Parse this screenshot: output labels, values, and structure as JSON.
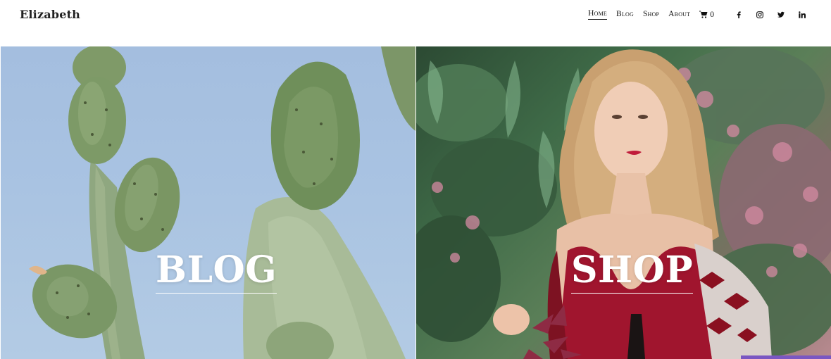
{
  "site": {
    "logo": "Elizabeth"
  },
  "nav": {
    "items": [
      {
        "label": "Home",
        "active": true
      },
      {
        "label": "Blog",
        "active": false
      },
      {
        "label": "Shop",
        "active": false
      },
      {
        "label": "About",
        "active": false
      }
    ],
    "cart": {
      "icon": "cart-icon",
      "count": "0"
    },
    "social": [
      "facebook-icon",
      "instagram-icon",
      "twitter-icon",
      "linkedin-icon"
    ]
  },
  "panels": {
    "blog": {
      "title": "BLOG",
      "image": "cactus-photo"
    },
    "shop": {
      "title": "SHOP",
      "image": "woman-in-garden-photo"
    }
  },
  "colors": {
    "accent_bar": "#7a57c2",
    "text_on_image": "#ffffff"
  }
}
